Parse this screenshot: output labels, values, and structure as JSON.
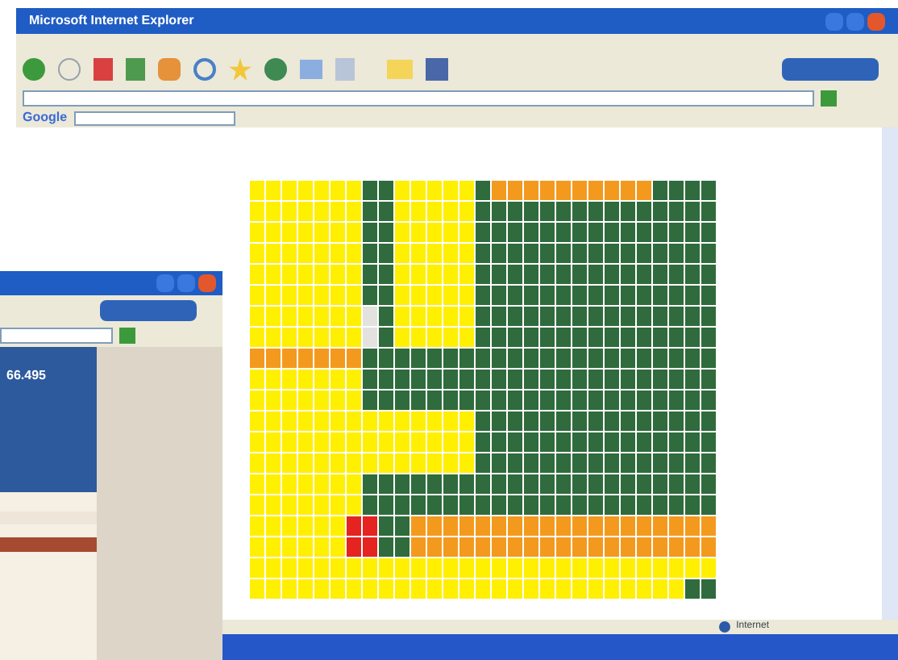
{
  "back_window": {
    "title": "Microsoft Internet Explorer",
    "search_brand": "Google",
    "status": "Internet"
  },
  "front_window": {
    "banner_value": "66.495"
  },
  "grid": {
    "rows": [
      [
        {
          "color": "#ffef00"
        },
        {
          "color": "#ffef00"
        },
        {
          "color": "#ffef00"
        },
        {
          "color": "#ffef00"
        },
        {
          "color": "#ffef00"
        },
        {
          "color": "#ffef00"
        },
        {
          "color": "#ffef00"
        },
        {
          "color": "#2f6b3c"
        },
        {
          "color": "#2f6b3c"
        },
        {
          "color": "#ffef00"
        },
        {
          "color": "#ffef00"
        },
        {
          "color": "#ffef00"
        },
        {
          "color": "#ffef00"
        },
        {
          "color": "#ffef00"
        },
        {
          "color": "#2f6b3c"
        },
        {
          "color": "#f39a1e"
        },
        {
          "color": "#f39a1e"
        },
        {
          "color": "#f39a1e"
        },
        {
          "color": "#f39a1e"
        },
        {
          "color": "#f39a1e"
        },
        {
          "color": "#f39a1e"
        },
        {
          "color": "#f39a1e"
        },
        {
          "color": "#f39a1e"
        },
        {
          "color": "#f39a1e"
        },
        {
          "color": "#f39a1e"
        },
        {
          "color": "#2f6b3c"
        },
        {
          "color": "#2f6b3c"
        },
        {
          "color": "#2f6b3c"
        },
        {
          "color": "#2f6b3c"
        }
      ],
      [
        {
          "color": "#ffef00"
        },
        {
          "color": "#ffef00"
        },
        {
          "color": "#ffef00"
        },
        {
          "color": "#ffef00"
        },
        {
          "color": "#ffef00"
        },
        {
          "color": "#ffef00"
        },
        {
          "color": "#ffef00"
        },
        {
          "color": "#2f6b3c"
        },
        {
          "color": "#2f6b3c"
        },
        {
          "color": "#ffef00"
        },
        {
          "color": "#ffef00"
        },
        {
          "color": "#ffef00"
        },
        {
          "color": "#ffef00"
        },
        {
          "color": "#ffef00"
        },
        {
          "color": "#2f6b3c"
        },
        {
          "color": "#2f6b3c"
        },
        {
          "color": "#2f6b3c"
        },
        {
          "color": "#2f6b3c"
        },
        {
          "color": "#2f6b3c"
        },
        {
          "color": "#2f6b3c"
        },
        {
          "color": "#2f6b3c"
        },
        {
          "color": "#2f6b3c"
        },
        {
          "color": "#2f6b3c"
        },
        {
          "color": "#2f6b3c"
        },
        {
          "color": "#2f6b3c"
        },
        {
          "color": "#2f6b3c"
        },
        {
          "color": "#2f6b3c"
        },
        {
          "color": "#2f6b3c"
        },
        {
          "color": "#2f6b3c"
        }
      ],
      [
        {
          "color": "#ffef00"
        },
        {
          "color": "#ffef00"
        },
        {
          "color": "#ffef00"
        },
        {
          "color": "#ffef00"
        },
        {
          "color": "#ffef00"
        },
        {
          "color": "#ffef00"
        },
        {
          "color": "#ffef00"
        },
        {
          "color": "#2f6b3c"
        },
        {
          "color": "#2f6b3c"
        },
        {
          "color": "#ffef00"
        },
        {
          "color": "#ffef00"
        },
        {
          "color": "#ffef00"
        },
        {
          "color": "#ffef00"
        },
        {
          "color": "#ffef00"
        },
        {
          "color": "#2f6b3c"
        },
        {
          "color": "#2f6b3c"
        },
        {
          "color": "#2f6b3c"
        },
        {
          "color": "#2f6b3c"
        },
        {
          "color": "#2f6b3c"
        },
        {
          "color": "#2f6b3c"
        },
        {
          "color": "#2f6b3c"
        },
        {
          "color": "#2f6b3c"
        },
        {
          "color": "#2f6b3c"
        },
        {
          "color": "#2f6b3c"
        },
        {
          "color": "#2f6b3c"
        },
        {
          "color": "#2f6b3c"
        },
        {
          "color": "#2f6b3c"
        },
        {
          "color": "#2f6b3c"
        },
        {
          "color": "#2f6b3c"
        }
      ],
      [
        {
          "color": "#ffef00"
        },
        {
          "color": "#ffef00"
        },
        {
          "color": "#ffef00"
        },
        {
          "color": "#ffef00"
        },
        {
          "color": "#ffef00"
        },
        {
          "color": "#ffef00"
        },
        {
          "color": "#ffef00"
        },
        {
          "color": "#2f6b3c"
        },
        {
          "color": "#2f6b3c"
        },
        {
          "color": "#ffef00"
        },
        {
          "color": "#ffef00"
        },
        {
          "color": "#ffef00"
        },
        {
          "color": "#ffef00"
        },
        {
          "color": "#ffef00"
        },
        {
          "color": "#2f6b3c"
        },
        {
          "color": "#2f6b3c"
        },
        {
          "color": "#2f6b3c"
        },
        {
          "color": "#2f6b3c"
        },
        {
          "color": "#2f6b3c"
        },
        {
          "color": "#2f6b3c"
        },
        {
          "color": "#2f6b3c"
        },
        {
          "color": "#2f6b3c"
        },
        {
          "color": "#2f6b3c"
        },
        {
          "color": "#2f6b3c"
        },
        {
          "color": "#2f6b3c"
        },
        {
          "color": "#2f6b3c"
        },
        {
          "color": "#2f6b3c"
        },
        {
          "color": "#2f6b3c"
        },
        {
          "color": "#2f6b3c"
        }
      ],
      [
        {
          "color": "#ffef00"
        },
        {
          "color": "#ffef00"
        },
        {
          "color": "#ffef00"
        },
        {
          "color": "#ffef00"
        },
        {
          "color": "#ffef00"
        },
        {
          "color": "#ffef00"
        },
        {
          "color": "#ffef00"
        },
        {
          "color": "#2f6b3c"
        },
        {
          "color": "#2f6b3c"
        },
        {
          "color": "#ffef00"
        },
        {
          "color": "#ffef00"
        },
        {
          "color": "#ffef00"
        },
        {
          "color": "#ffef00"
        },
        {
          "color": "#ffef00"
        },
        {
          "color": "#2f6b3c"
        },
        {
          "color": "#2f6b3c"
        },
        {
          "color": "#2f6b3c"
        },
        {
          "color": "#2f6b3c"
        },
        {
          "color": "#2f6b3c"
        },
        {
          "color": "#2f6b3c"
        },
        {
          "color": "#2f6b3c"
        },
        {
          "color": "#2f6b3c"
        },
        {
          "color": "#2f6b3c"
        },
        {
          "color": "#2f6b3c"
        },
        {
          "color": "#2f6b3c"
        },
        {
          "color": "#2f6b3c"
        },
        {
          "color": "#2f6b3c"
        },
        {
          "color": "#2f6b3c"
        },
        {
          "color": "#2f6b3c"
        }
      ],
      [
        {
          "color": "#ffef00"
        },
        {
          "color": "#ffef00"
        },
        {
          "color": "#ffef00"
        },
        {
          "color": "#ffef00"
        },
        {
          "color": "#ffef00"
        },
        {
          "color": "#ffef00"
        },
        {
          "color": "#ffef00"
        },
        {
          "color": "#2f6b3c"
        },
        {
          "color": "#2f6b3c"
        },
        {
          "color": "#ffef00"
        },
        {
          "color": "#ffef00"
        },
        {
          "color": "#ffef00"
        },
        {
          "color": "#ffef00"
        },
        {
          "color": "#ffef00"
        },
        {
          "color": "#2f6b3c"
        },
        {
          "color": "#2f6b3c"
        },
        {
          "color": "#2f6b3c"
        },
        {
          "color": "#2f6b3c"
        },
        {
          "color": "#2f6b3c"
        },
        {
          "color": "#2f6b3c"
        },
        {
          "color": "#2f6b3c"
        },
        {
          "color": "#2f6b3c"
        },
        {
          "color": "#2f6b3c"
        },
        {
          "color": "#2f6b3c"
        },
        {
          "color": "#2f6b3c"
        },
        {
          "color": "#2f6b3c"
        },
        {
          "color": "#2f6b3c"
        },
        {
          "color": "#2f6b3c"
        },
        {
          "color": "#2f6b3c"
        }
      ],
      [
        {
          "color": "#ffef00"
        },
        {
          "color": "#ffef00"
        },
        {
          "color": "#ffef00"
        },
        {
          "color": "#ffef00"
        },
        {
          "color": "#ffef00"
        },
        {
          "color": "#ffef00"
        },
        {
          "color": "#ffef00"
        },
        {
          "color": "#e4e2de"
        },
        {
          "color": "#2f6b3c"
        },
        {
          "color": "#ffef00"
        },
        {
          "color": "#ffef00"
        },
        {
          "color": "#ffef00"
        },
        {
          "color": "#ffef00"
        },
        {
          "color": "#ffef00"
        },
        {
          "color": "#2f6b3c"
        },
        {
          "color": "#2f6b3c"
        },
        {
          "color": "#2f6b3c"
        },
        {
          "color": "#2f6b3c"
        },
        {
          "color": "#2f6b3c"
        },
        {
          "color": "#2f6b3c"
        },
        {
          "color": "#2f6b3c"
        },
        {
          "color": "#2f6b3c"
        },
        {
          "color": "#2f6b3c"
        },
        {
          "color": "#2f6b3c"
        },
        {
          "color": "#2f6b3c"
        },
        {
          "color": "#2f6b3c"
        },
        {
          "color": "#2f6b3c"
        },
        {
          "color": "#2f6b3c"
        },
        {
          "color": "#2f6b3c"
        }
      ],
      [
        {
          "color": "#ffef00"
        },
        {
          "color": "#ffef00"
        },
        {
          "color": "#ffef00"
        },
        {
          "color": "#ffef00"
        },
        {
          "color": "#ffef00"
        },
        {
          "color": "#ffef00"
        },
        {
          "color": "#ffef00"
        },
        {
          "color": "#e4e2de"
        },
        {
          "color": "#2f6b3c"
        },
        {
          "color": "#ffef00"
        },
        {
          "color": "#ffef00"
        },
        {
          "color": "#ffef00"
        },
        {
          "color": "#ffef00"
        },
        {
          "color": "#ffef00"
        },
        {
          "color": "#2f6b3c"
        },
        {
          "color": "#2f6b3c"
        },
        {
          "color": "#2f6b3c"
        },
        {
          "color": "#2f6b3c"
        },
        {
          "color": "#2f6b3c"
        },
        {
          "color": "#2f6b3c"
        },
        {
          "color": "#2f6b3c"
        },
        {
          "color": "#2f6b3c"
        },
        {
          "color": "#2f6b3c"
        },
        {
          "color": "#2f6b3c"
        },
        {
          "color": "#2f6b3c"
        },
        {
          "color": "#2f6b3c"
        },
        {
          "color": "#2f6b3c"
        },
        {
          "color": "#2f6b3c"
        },
        {
          "color": "#2f6b3c"
        }
      ],
      [
        {
          "color": "#f39a1e"
        },
        {
          "color": "#f39a1e"
        },
        {
          "color": "#f39a1e"
        },
        {
          "color": "#f39a1e"
        },
        {
          "color": "#f39a1e"
        },
        {
          "color": "#f39a1e"
        },
        {
          "color": "#f39a1e"
        },
        {
          "color": "#2f6b3c"
        },
        {
          "color": "#2f6b3c"
        },
        {
          "color": "#2f6b3c"
        },
        {
          "color": "#2f6b3c"
        },
        {
          "color": "#2f6b3c"
        },
        {
          "color": "#2f6b3c"
        },
        {
          "color": "#2f6b3c"
        },
        {
          "color": "#2f6b3c"
        },
        {
          "color": "#2f6b3c"
        },
        {
          "color": "#2f6b3c"
        },
        {
          "color": "#2f6b3c"
        },
        {
          "color": "#2f6b3c"
        },
        {
          "color": "#2f6b3c"
        },
        {
          "color": "#2f6b3c"
        },
        {
          "color": "#2f6b3c"
        },
        {
          "color": "#2f6b3c"
        },
        {
          "color": "#2f6b3c"
        },
        {
          "color": "#2f6b3c"
        },
        {
          "color": "#2f6b3c"
        },
        {
          "color": "#2f6b3c"
        },
        {
          "color": "#2f6b3c"
        },
        {
          "color": "#2f6b3c"
        }
      ],
      [
        {
          "color": "#ffef00"
        },
        {
          "color": "#ffef00"
        },
        {
          "color": "#ffef00"
        },
        {
          "color": "#ffef00"
        },
        {
          "color": "#ffef00"
        },
        {
          "color": "#ffef00"
        },
        {
          "color": "#ffef00"
        },
        {
          "color": "#2f6b3c"
        },
        {
          "color": "#2f6b3c"
        },
        {
          "color": "#2f6b3c"
        },
        {
          "color": "#2f6b3c"
        },
        {
          "color": "#2f6b3c"
        },
        {
          "color": "#2f6b3c"
        },
        {
          "color": "#2f6b3c"
        },
        {
          "color": "#2f6b3c"
        },
        {
          "color": "#2f6b3c"
        },
        {
          "color": "#2f6b3c"
        },
        {
          "color": "#2f6b3c"
        },
        {
          "color": "#2f6b3c"
        },
        {
          "color": "#2f6b3c"
        },
        {
          "color": "#2f6b3c"
        },
        {
          "color": "#2f6b3c"
        },
        {
          "color": "#2f6b3c"
        },
        {
          "color": "#2f6b3c"
        },
        {
          "color": "#2f6b3c"
        },
        {
          "color": "#2f6b3c"
        },
        {
          "color": "#2f6b3c"
        },
        {
          "color": "#2f6b3c"
        },
        {
          "color": "#2f6b3c"
        }
      ],
      [
        {
          "color": "#ffef00"
        },
        {
          "color": "#ffef00"
        },
        {
          "color": "#ffef00"
        },
        {
          "color": "#ffef00"
        },
        {
          "color": "#ffef00"
        },
        {
          "color": "#ffef00"
        },
        {
          "color": "#ffef00"
        },
        {
          "color": "#2f6b3c"
        },
        {
          "color": "#2f6b3c"
        },
        {
          "color": "#2f6b3c"
        },
        {
          "color": "#2f6b3c"
        },
        {
          "color": "#2f6b3c"
        },
        {
          "color": "#2f6b3c"
        },
        {
          "color": "#2f6b3c"
        },
        {
          "color": "#2f6b3c"
        },
        {
          "color": "#2f6b3c"
        },
        {
          "color": "#2f6b3c"
        },
        {
          "color": "#2f6b3c"
        },
        {
          "color": "#2f6b3c"
        },
        {
          "color": "#2f6b3c"
        },
        {
          "color": "#2f6b3c"
        },
        {
          "color": "#2f6b3c"
        },
        {
          "color": "#2f6b3c"
        },
        {
          "color": "#2f6b3c"
        },
        {
          "color": "#2f6b3c"
        },
        {
          "color": "#2f6b3c"
        },
        {
          "color": "#2f6b3c"
        },
        {
          "color": "#2f6b3c"
        },
        {
          "color": "#2f6b3c"
        }
      ],
      [
        {
          "color": "#ffef00"
        },
        {
          "color": "#ffef00"
        },
        {
          "color": "#ffef00"
        },
        {
          "color": "#ffef00"
        },
        {
          "color": "#ffef00"
        },
        {
          "color": "#ffef00"
        },
        {
          "color": "#ffef00"
        },
        {
          "color": "#ffef00"
        },
        {
          "color": "#ffef00"
        },
        {
          "color": "#ffef00"
        },
        {
          "color": "#ffef00"
        },
        {
          "color": "#ffef00"
        },
        {
          "color": "#ffef00"
        },
        {
          "color": "#ffef00"
        },
        {
          "color": "#2f6b3c"
        },
        {
          "color": "#2f6b3c"
        },
        {
          "color": "#2f6b3c"
        },
        {
          "color": "#2f6b3c"
        },
        {
          "color": "#2f6b3c"
        },
        {
          "color": "#2f6b3c"
        },
        {
          "color": "#2f6b3c"
        },
        {
          "color": "#2f6b3c"
        },
        {
          "color": "#2f6b3c"
        },
        {
          "color": "#2f6b3c"
        },
        {
          "color": "#2f6b3c"
        },
        {
          "color": "#2f6b3c"
        },
        {
          "color": "#2f6b3c"
        },
        {
          "color": "#2f6b3c"
        },
        {
          "color": "#2f6b3c"
        }
      ],
      [
        {
          "color": "#ffef00"
        },
        {
          "color": "#ffef00"
        },
        {
          "color": "#ffef00"
        },
        {
          "color": "#ffef00"
        },
        {
          "color": "#ffef00"
        },
        {
          "color": "#ffef00"
        },
        {
          "color": "#ffef00"
        },
        {
          "color": "#ffef00"
        },
        {
          "color": "#ffef00"
        },
        {
          "color": "#ffef00"
        },
        {
          "color": "#ffef00"
        },
        {
          "color": "#ffef00"
        },
        {
          "color": "#ffef00"
        },
        {
          "color": "#ffef00"
        },
        {
          "color": "#2f6b3c"
        },
        {
          "color": "#2f6b3c"
        },
        {
          "color": "#2f6b3c"
        },
        {
          "color": "#2f6b3c"
        },
        {
          "color": "#2f6b3c"
        },
        {
          "color": "#2f6b3c"
        },
        {
          "color": "#2f6b3c"
        },
        {
          "color": "#2f6b3c"
        },
        {
          "color": "#2f6b3c"
        },
        {
          "color": "#2f6b3c"
        },
        {
          "color": "#2f6b3c"
        },
        {
          "color": "#2f6b3c"
        },
        {
          "color": "#2f6b3c"
        },
        {
          "color": "#2f6b3c"
        },
        {
          "color": "#2f6b3c"
        }
      ],
      [
        {
          "color": "#ffef00"
        },
        {
          "color": "#ffef00"
        },
        {
          "color": "#ffef00"
        },
        {
          "color": "#ffef00"
        },
        {
          "color": "#ffef00"
        },
        {
          "color": "#ffef00"
        },
        {
          "color": "#ffef00"
        },
        {
          "color": "#ffef00"
        },
        {
          "color": "#ffef00"
        },
        {
          "color": "#ffef00"
        },
        {
          "color": "#ffef00"
        },
        {
          "color": "#ffef00"
        },
        {
          "color": "#ffef00"
        },
        {
          "color": "#ffef00"
        },
        {
          "color": "#2f6b3c"
        },
        {
          "color": "#2f6b3c"
        },
        {
          "color": "#2f6b3c"
        },
        {
          "color": "#2f6b3c"
        },
        {
          "color": "#2f6b3c"
        },
        {
          "color": "#2f6b3c"
        },
        {
          "color": "#2f6b3c"
        },
        {
          "color": "#2f6b3c"
        },
        {
          "color": "#2f6b3c"
        },
        {
          "color": "#2f6b3c"
        },
        {
          "color": "#2f6b3c"
        },
        {
          "color": "#2f6b3c"
        },
        {
          "color": "#2f6b3c"
        },
        {
          "color": "#2f6b3c"
        },
        {
          "color": "#2f6b3c"
        }
      ],
      [
        {
          "color": "#ffef00"
        },
        {
          "color": "#ffef00"
        },
        {
          "color": "#ffef00"
        },
        {
          "color": "#ffef00"
        },
        {
          "color": "#ffef00"
        },
        {
          "color": "#ffef00"
        },
        {
          "color": "#ffef00"
        },
        {
          "color": "#2f6b3c"
        },
        {
          "color": "#2f6b3c"
        },
        {
          "color": "#2f6b3c"
        },
        {
          "color": "#2f6b3c"
        },
        {
          "color": "#2f6b3c"
        },
        {
          "color": "#2f6b3c"
        },
        {
          "color": "#2f6b3c"
        },
        {
          "color": "#2f6b3c"
        },
        {
          "color": "#2f6b3c"
        },
        {
          "color": "#2f6b3c"
        },
        {
          "color": "#2f6b3c"
        },
        {
          "color": "#2f6b3c"
        },
        {
          "color": "#2f6b3c"
        },
        {
          "color": "#2f6b3c"
        },
        {
          "color": "#2f6b3c"
        },
        {
          "color": "#2f6b3c"
        },
        {
          "color": "#2f6b3c"
        },
        {
          "color": "#2f6b3c"
        },
        {
          "color": "#2f6b3c"
        },
        {
          "color": "#2f6b3c"
        },
        {
          "color": "#2f6b3c"
        },
        {
          "color": "#2f6b3c"
        }
      ],
      [
        {
          "color": "#ffef00"
        },
        {
          "color": "#ffef00"
        },
        {
          "color": "#ffef00"
        },
        {
          "color": "#ffef00"
        },
        {
          "color": "#ffef00"
        },
        {
          "color": "#ffef00"
        },
        {
          "color": "#ffef00"
        },
        {
          "color": "#2f6b3c"
        },
        {
          "color": "#2f6b3c"
        },
        {
          "color": "#2f6b3c"
        },
        {
          "color": "#2f6b3c"
        },
        {
          "color": "#2f6b3c"
        },
        {
          "color": "#2f6b3c"
        },
        {
          "color": "#2f6b3c"
        },
        {
          "color": "#2f6b3c"
        },
        {
          "color": "#2f6b3c"
        },
        {
          "color": "#2f6b3c"
        },
        {
          "color": "#2f6b3c"
        },
        {
          "color": "#2f6b3c"
        },
        {
          "color": "#2f6b3c"
        },
        {
          "color": "#2f6b3c"
        },
        {
          "color": "#2f6b3c"
        },
        {
          "color": "#2f6b3c"
        },
        {
          "color": "#2f6b3c"
        },
        {
          "color": "#2f6b3c"
        },
        {
          "color": "#2f6b3c"
        },
        {
          "color": "#2f6b3c"
        },
        {
          "color": "#2f6b3c"
        },
        {
          "color": "#2f6b3c"
        }
      ],
      [
        {
          "color": "#ffef00"
        },
        {
          "color": "#ffef00"
        },
        {
          "color": "#ffef00"
        },
        {
          "color": "#ffef00"
        },
        {
          "color": "#ffef00"
        },
        {
          "color": "#ffef00"
        },
        {
          "color": "#e52320"
        },
        {
          "color": "#e52320"
        },
        {
          "color": "#2f6b3c"
        },
        {
          "color": "#2f6b3c"
        },
        {
          "color": "#f39a1e"
        },
        {
          "color": "#f39a1e"
        },
        {
          "color": "#f39a1e"
        },
        {
          "color": "#f39a1e"
        },
        {
          "color": "#f39a1e"
        },
        {
          "color": "#f39a1e"
        },
        {
          "color": "#f39a1e"
        },
        {
          "color": "#f39a1e"
        },
        {
          "color": "#f39a1e"
        },
        {
          "color": "#f39a1e"
        },
        {
          "color": "#f39a1e"
        },
        {
          "color": "#f39a1e"
        },
        {
          "color": "#f39a1e"
        },
        {
          "color": "#f39a1e"
        },
        {
          "color": "#f39a1e"
        },
        {
          "color": "#f39a1e"
        },
        {
          "color": "#f39a1e"
        },
        {
          "color": "#f39a1e"
        },
        {
          "color": "#f39a1e"
        }
      ],
      [
        {
          "color": "#ffef00"
        },
        {
          "color": "#ffef00"
        },
        {
          "color": "#ffef00"
        },
        {
          "color": "#ffef00"
        },
        {
          "color": "#ffef00"
        },
        {
          "color": "#ffef00"
        },
        {
          "color": "#e52320"
        },
        {
          "color": "#e52320"
        },
        {
          "color": "#2f6b3c"
        },
        {
          "color": "#2f6b3c"
        },
        {
          "color": "#f39a1e"
        },
        {
          "color": "#f39a1e"
        },
        {
          "color": "#f39a1e"
        },
        {
          "color": "#f39a1e"
        },
        {
          "color": "#f39a1e"
        },
        {
          "color": "#f39a1e"
        },
        {
          "color": "#f39a1e"
        },
        {
          "color": "#f39a1e"
        },
        {
          "color": "#f39a1e"
        },
        {
          "color": "#f39a1e"
        },
        {
          "color": "#f39a1e"
        },
        {
          "color": "#f39a1e"
        },
        {
          "color": "#f39a1e"
        },
        {
          "color": "#f39a1e"
        },
        {
          "color": "#f39a1e"
        },
        {
          "color": "#f39a1e"
        },
        {
          "color": "#f39a1e"
        },
        {
          "color": "#f39a1e"
        },
        {
          "color": "#f39a1e"
        }
      ],
      [
        {
          "color": "#ffef00"
        },
        {
          "color": "#ffef00"
        },
        {
          "color": "#ffef00"
        },
        {
          "color": "#ffef00"
        },
        {
          "color": "#ffef00"
        },
        {
          "color": "#ffef00"
        },
        {
          "color": "#ffef00"
        },
        {
          "color": "#ffef00"
        },
        {
          "color": "#ffef00"
        },
        {
          "color": "#ffef00"
        },
        {
          "color": "#ffef00"
        },
        {
          "color": "#ffef00"
        },
        {
          "color": "#ffef00"
        },
        {
          "color": "#ffef00"
        },
        {
          "color": "#ffef00"
        },
        {
          "color": "#ffef00"
        },
        {
          "color": "#ffef00"
        },
        {
          "color": "#ffef00"
        },
        {
          "color": "#ffef00"
        },
        {
          "color": "#ffef00"
        },
        {
          "color": "#ffef00"
        },
        {
          "color": "#ffef00"
        },
        {
          "color": "#ffef00"
        },
        {
          "color": "#ffef00"
        },
        {
          "color": "#ffef00"
        },
        {
          "color": "#ffef00"
        },
        {
          "color": "#ffef00"
        },
        {
          "color": "#ffef00"
        },
        {
          "color": "#ffef00"
        }
      ],
      [
        {
          "color": "#ffef00"
        },
        {
          "color": "#ffef00"
        },
        {
          "color": "#ffef00"
        },
        {
          "color": "#ffef00"
        },
        {
          "color": "#ffef00"
        },
        {
          "color": "#ffef00"
        },
        {
          "color": "#ffef00"
        },
        {
          "color": "#ffef00"
        },
        {
          "color": "#ffef00"
        },
        {
          "color": "#ffef00"
        },
        {
          "color": "#ffef00"
        },
        {
          "color": "#ffef00"
        },
        {
          "color": "#ffef00"
        },
        {
          "color": "#ffef00"
        },
        {
          "color": "#ffef00"
        },
        {
          "color": "#ffef00"
        },
        {
          "color": "#ffef00"
        },
        {
          "color": "#ffef00"
        },
        {
          "color": "#ffef00"
        },
        {
          "color": "#ffef00"
        },
        {
          "color": "#ffef00"
        },
        {
          "color": "#ffef00"
        },
        {
          "color": "#ffef00"
        },
        {
          "color": "#ffef00"
        },
        {
          "color": "#ffef00"
        },
        {
          "color": "#ffef00"
        },
        {
          "color": "#ffef00"
        },
        {
          "color": "#2f6b3c"
        },
        {
          "color": "#2f6b3c"
        }
      ]
    ]
  }
}
